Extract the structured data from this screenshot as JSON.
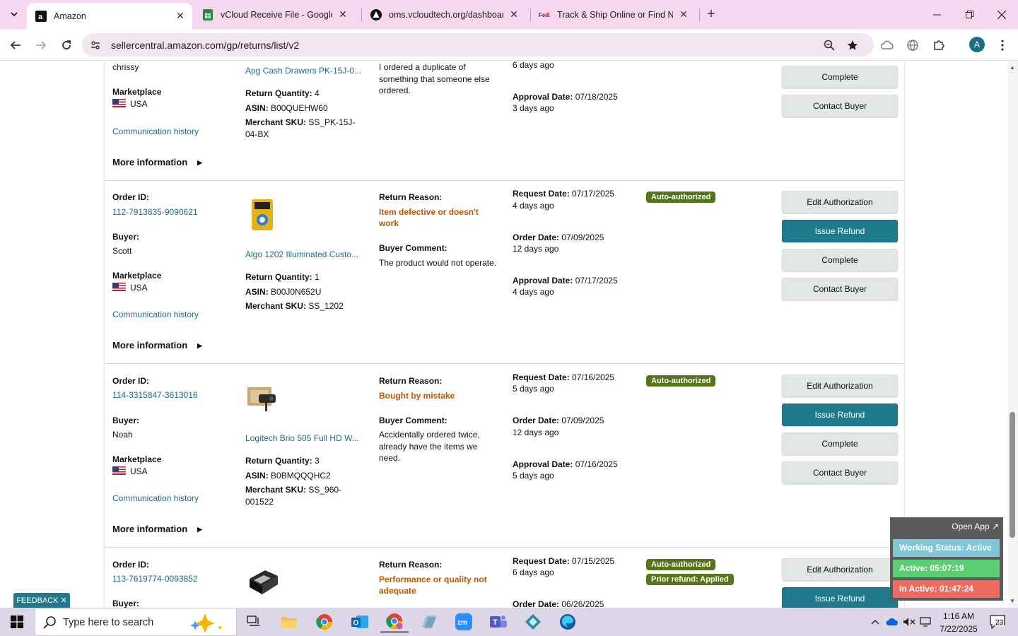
{
  "browser": {
    "tabs": [
      {
        "title": "Amazon",
        "active": true
      },
      {
        "title": "vCloud Receive File - Google Sh",
        "active": false
      },
      {
        "title": "oms.vcloudtech.org/dashboard",
        "active": false
      },
      {
        "title": "Track & Ship Online or Find Ne",
        "active": false
      }
    ],
    "url": "sellercentral.amazon.com/gp/returns/list/v2",
    "profile_initial": "A"
  },
  "returns": [
    {
      "buyer": "chrissy",
      "marketplace_label": "Marketplace",
      "marketplace": "USA",
      "communication_link": "Communication history",
      "product_title": "Apg Cash Drawers PK-15J-0...",
      "return_quantity_label": "Return Quantity:",
      "return_quantity": "4",
      "asin_label": "ASIN:",
      "asin": "B00QUEHW60",
      "sku_label": "Merchant SKU:",
      "sku": "SS_PK-15J-04-BX",
      "comment": "I ordered a duplicate of something that someone else ordered.",
      "order_date_ago": "6 days ago",
      "approval_label": "Approval Date:",
      "approval_date": "07/18/2025",
      "approval_ago": "3 days ago",
      "more_info": "More information",
      "buttons": [
        "Complete",
        "Contact Buyer"
      ]
    },
    {
      "order_id_label": "Order ID:",
      "order_id": "112-7913835-9090621",
      "buyer_label": "Buyer:",
      "buyer": "Scott",
      "marketplace_label": "Marketplace",
      "marketplace": "USA",
      "communication_link": "Communication history",
      "product_title": "Algo 1202 Illuminated Custo...",
      "return_quantity_label": "Return Quantity:",
      "return_quantity": "1",
      "asin_label": "ASIN:",
      "asin": "B00J0N652U",
      "sku_label": "Merchant SKU:",
      "sku": "SS_1202",
      "reason_label": "Return Reason:",
      "reason": "Item defective or doesn't work",
      "comment_label": "Buyer Comment:",
      "comment": "The product would not operate.",
      "request_label": "Request Date:",
      "request_date": "07/17/2025",
      "request_ago": "4 days ago",
      "order_label": "Order Date:",
      "order_date": "07/09/2025",
      "order_ago": "12 days ago",
      "approval_label": "Approval Date:",
      "approval_date": "07/17/2025",
      "approval_ago": "4 days ago",
      "badge": "Auto-authorized",
      "more_info": "More information",
      "buttons": [
        "Edit Authorization",
        "Issue Refund",
        "Complete",
        "Contact Buyer"
      ]
    },
    {
      "order_id_label": "Order ID:",
      "order_id": "114-3315847-3613016",
      "buyer_label": "Buyer:",
      "buyer": "Noah",
      "marketplace_label": "Marketplace",
      "marketplace": "USA",
      "communication_link": "Communication history",
      "product_title": "Logitech Brio 505 Full HD W...",
      "return_quantity_label": "Return Quantity:",
      "return_quantity": "3",
      "asin_label": "ASIN:",
      "asin": "B0BMQQQHC2",
      "sku_label": "Merchant SKU:",
      "sku": "SS_960-001522",
      "reason_label": "Return Reason:",
      "reason": "Bought by mistake",
      "comment_label": "Buyer Comment:",
      "comment": "Accidentally ordered twice, already have the items we need.",
      "request_label": "Request Date:",
      "request_date": "07/16/2025",
      "request_ago": "5 days ago",
      "order_label": "Order Date:",
      "order_date": "07/09/2025",
      "order_ago": "12 days ago",
      "approval_label": "Approval Date:",
      "approval_date": "07/16/2025",
      "approval_ago": "5 days ago",
      "badge": "Auto-authorized",
      "more_info": "More information",
      "buttons": [
        "Edit Authorization",
        "Issue Refund",
        "Complete",
        "Contact Buyer"
      ]
    },
    {
      "order_id_label": "Order ID:",
      "order_id": "113-7619774-0093852",
      "buyer_label": "Buyer:",
      "reason_label": "Return Reason:",
      "reason": "Performance or quality not adequate",
      "request_label": "Request Date:",
      "request_date": "07/15/2025",
      "request_ago": "6 days ago",
      "order_label": "Order Date:",
      "order_date": "06/26/2025",
      "badge": "Auto-authorized",
      "badge2": "Prior refund: Applied",
      "buttons": [
        "Edit Authorization",
        "Issue Refund"
      ]
    }
  ],
  "feedback": "FEEDBACK",
  "status_widget": {
    "open_app": "Open App",
    "working_status": "Working Status: Active",
    "active": "Active: 05:07:19",
    "inactive": "In Active: 01:47:24",
    "colors": {
      "working": "#7fc6d6",
      "active": "#5ccf73",
      "inactive": "#ef6b5f"
    }
  },
  "taskbar": {
    "search_placeholder": "Type here to search",
    "time": "1:16 AM",
    "date": "7/22/2025",
    "notifications": "23"
  }
}
